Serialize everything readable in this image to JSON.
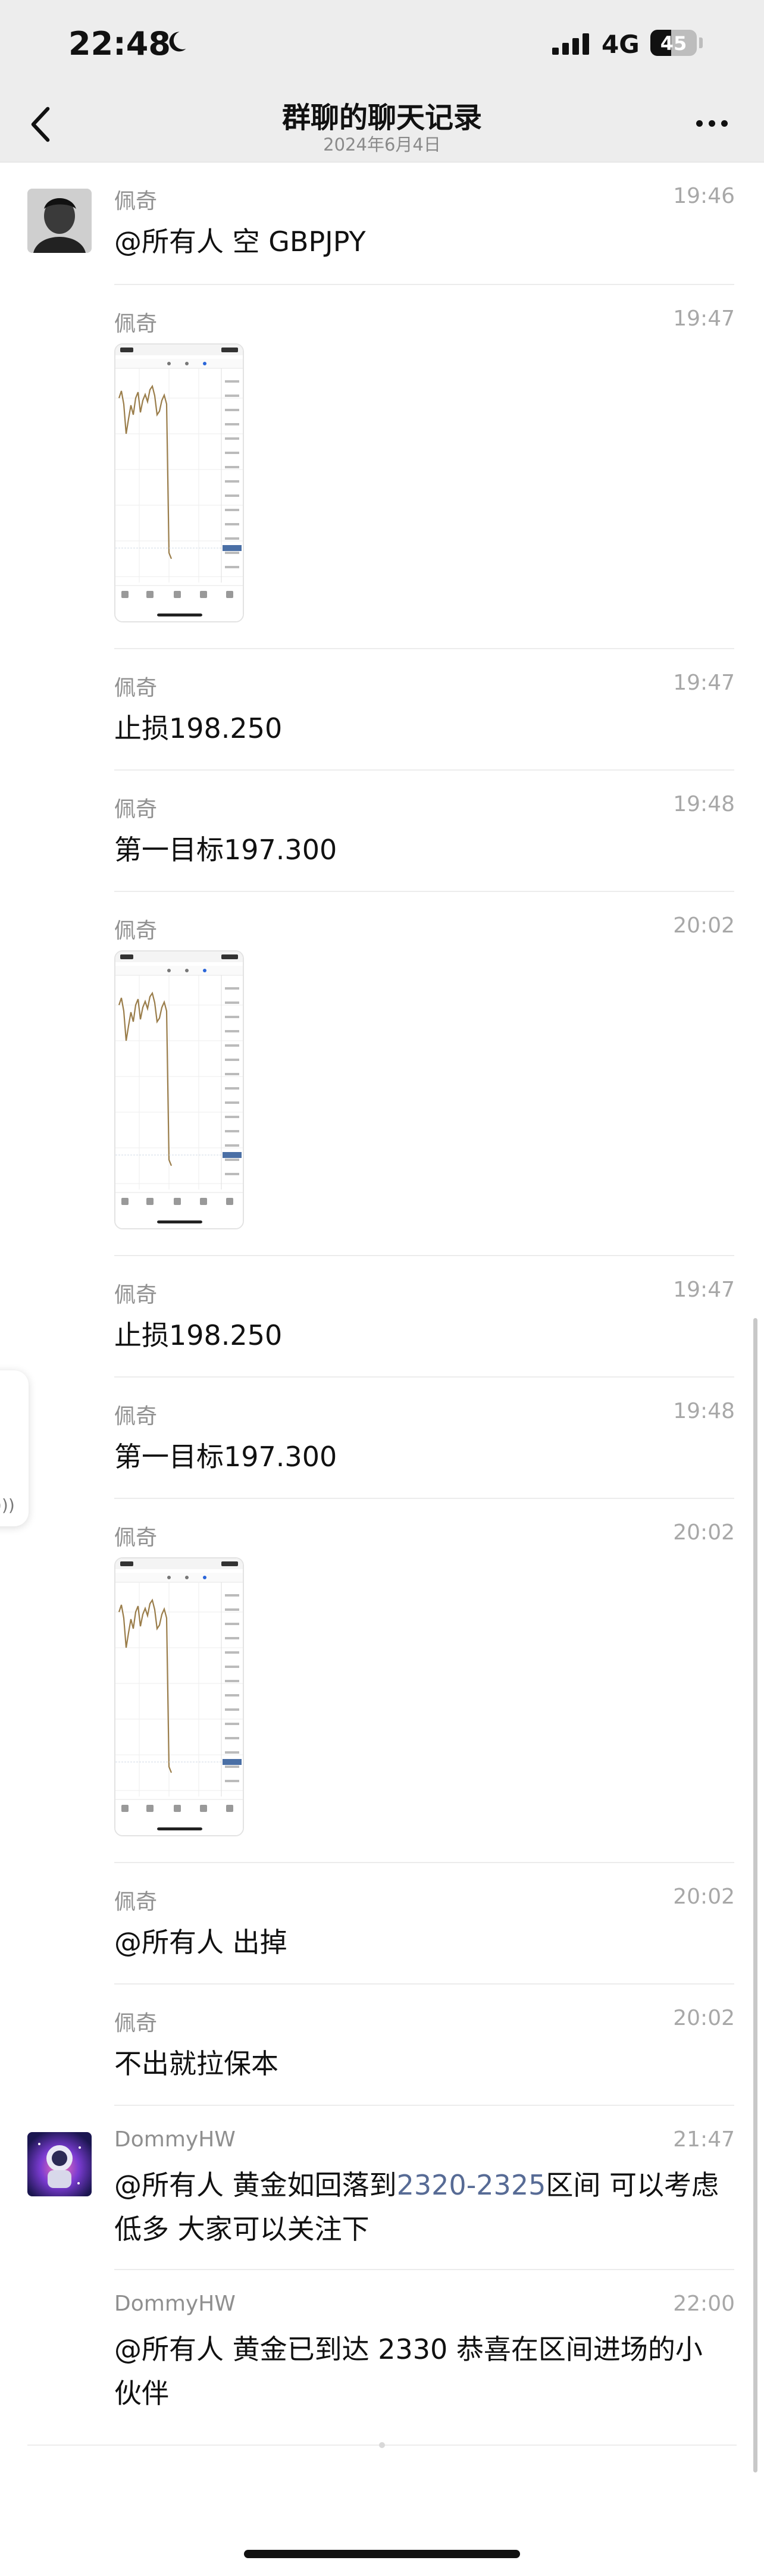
{
  "status_bar": {
    "time": "22:48",
    "network": "4G",
    "battery": "45",
    "battery_level": 0.45
  },
  "nav": {
    "title": "群聊的聊天记录",
    "subtitle": "2024年6月4日"
  },
  "messages": [
    {
      "sender": "佩奇",
      "time": "19:46",
      "show_avatar": true,
      "avatar": "peiqi",
      "type": "text",
      "text": "@所有人 空 GBPJPY"
    },
    {
      "sender": "佩奇",
      "time": "19:47",
      "show_avatar": false,
      "type": "image",
      "image": "chart-screenshot"
    },
    {
      "sender": "佩奇",
      "time": "19:47",
      "show_avatar": false,
      "type": "text",
      "text": "止损198.250"
    },
    {
      "sender": "佩奇",
      "time": "19:48",
      "show_avatar": false,
      "type": "text",
      "text": "第一目标197.300"
    },
    {
      "sender": "佩奇",
      "time": "20:02",
      "show_avatar": false,
      "type": "image",
      "image": "chart-screenshot"
    },
    {
      "sender": "佩奇",
      "time": "19:47",
      "show_avatar": false,
      "type": "text",
      "text": "止损198.250"
    },
    {
      "sender": "佩奇",
      "time": "19:48",
      "show_avatar": false,
      "type": "text",
      "text": "第一目标197.300"
    },
    {
      "sender": "佩奇",
      "time": "20:02",
      "show_avatar": false,
      "type": "image",
      "image": "chart-screenshot"
    },
    {
      "sender": "佩奇",
      "time": "20:02",
      "show_avatar": false,
      "type": "text",
      "text": "@所有人 出掉"
    },
    {
      "sender": "佩奇",
      "time": "20:02",
      "show_avatar": false,
      "type": "text",
      "text": "不出就拉保本"
    },
    {
      "sender": "DommyHW",
      "time": "21:47",
      "show_avatar": true,
      "avatar": "dommy",
      "type": "text",
      "parts": [
        {
          "t": "@所有人 黄金如回落到"
        },
        {
          "t": "2320-2325",
          "hl": true
        },
        {
          "t": "区间 可以考虑低多 大家可以关注下"
        }
      ]
    },
    {
      "sender": "DommyHW",
      "time": "22:00",
      "show_avatar": false,
      "type": "text",
      "text": "@所有人 黄金已到达 2330 恭喜在区间进场的小伙伴"
    }
  ],
  "colors": {
    "nav_bg": "#ededed",
    "link": "#576b95",
    "meta_text": "#a8a8a8"
  },
  "icons": {
    "back": "chevron-left-icon",
    "more": "more-dots-icon",
    "moon": "moon-icon",
    "signal": "signal-icon",
    "battery": "battery-icon"
  }
}
